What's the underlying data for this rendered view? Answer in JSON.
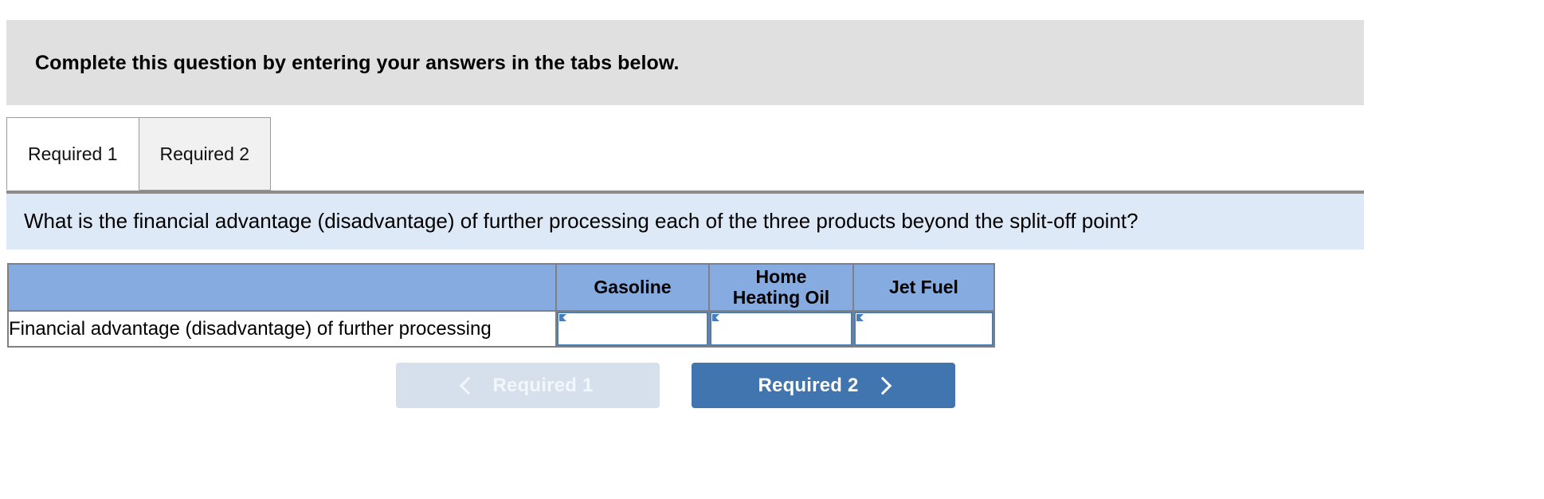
{
  "instruction": {
    "text": "Complete this question by entering your answers in the tabs below."
  },
  "tabs": [
    {
      "label": "Required 1",
      "state": "active"
    },
    {
      "label": "Required 2",
      "state": "inactive"
    }
  ],
  "question": {
    "text": "What is the financial advantage (disadvantage) of further processing each of the three products beyond the split-off point?"
  },
  "table": {
    "headers": [
      "",
      "Gasoline",
      "Home Heating Oil",
      "Jet Fuel"
    ],
    "header_gasoline": "Gasoline",
    "header_home_heating_oil_line1": "Home",
    "header_home_heating_oil_line2": "Heating Oil",
    "header_jet_fuel": "Jet Fuel",
    "rows": [
      {
        "label": "Financial advantage (disadvantage) of further processing",
        "values": [
          "",
          "",
          ""
        ]
      }
    ]
  },
  "navigation": {
    "prev_label": "Required 1",
    "next_label": "Required 2",
    "prev_icon": "chevron-left-icon",
    "next_icon": "chevron-right-icon",
    "prev_enabled": false,
    "next_enabled": true
  },
  "colors": {
    "banner_bg": "#e0e0e0",
    "question_bg": "#dee9f7",
    "table_header_bg": "#85abe0",
    "input_border": "#4a7ebb",
    "button_active_bg": "#4175b0",
    "button_disabled_bg": "#d6e0ed",
    "tab_active_bg": "#ffffff",
    "tab_inactive_bg": "#f1f1f1",
    "rule": "#8b8b8b"
  }
}
